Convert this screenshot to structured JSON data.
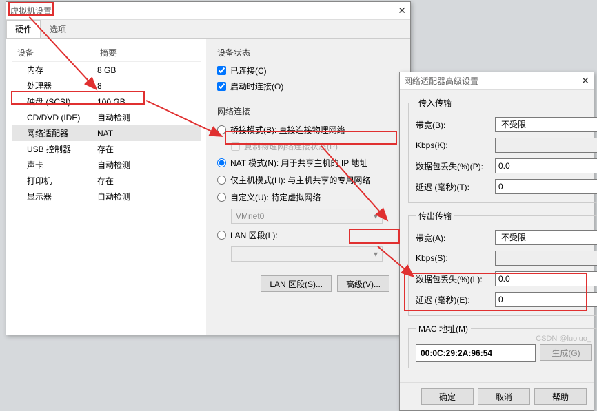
{
  "vm_settings": {
    "title": "虚拟机设置",
    "tabs": {
      "hardware": "硬件",
      "options": "选项"
    },
    "dev_header": {
      "device": "设备",
      "summary": "摘要"
    },
    "devices": [
      {
        "name": "内存",
        "summary": "8 GB",
        "icon": "memory-icon"
      },
      {
        "name": "处理器",
        "summary": "8",
        "icon": "cpu-icon"
      },
      {
        "name": "硬盘 (SCSI)",
        "summary": "100 GB",
        "icon": "disk-icon"
      },
      {
        "name": "CD/DVD (IDE)",
        "summary": "自动检测",
        "icon": "cd-icon"
      },
      {
        "name": "网络适配器",
        "summary": "NAT",
        "icon": "network-icon",
        "selected": true
      },
      {
        "name": "USB 控制器",
        "summary": "存在",
        "icon": "usb-icon"
      },
      {
        "name": "声卡",
        "summary": "自动检测",
        "icon": "sound-icon"
      },
      {
        "name": "打印机",
        "summary": "存在",
        "icon": "printer-icon"
      },
      {
        "name": "显示器",
        "summary": "自动检测",
        "icon": "display-icon"
      }
    ],
    "device_status": {
      "legend": "设备状态",
      "connected": "已连接(C)",
      "connect_at_poweron": "启动时连接(O)"
    },
    "network": {
      "legend": "网络连接",
      "bridged": "桥接模式(B): 直接连接物理网络",
      "replicate": "复制物理网络连接状态(P)",
      "nat": "NAT 模式(N): 用于共享主机的 IP 地址",
      "hostonly": "仅主机模式(H): 与主机共享的专用网络",
      "custom": "自定义(U): 特定虚拟网络",
      "vmnet": "VMnet0",
      "lan_segment": "LAN 区段(L):",
      "lan_btn": "LAN 区段(S)...",
      "advanced_btn": "高级(V)..."
    }
  },
  "advanced": {
    "title": "网络适配器高级设置",
    "incoming": {
      "legend": "传入传输",
      "bandwidth": "带宽(B):",
      "bandwidth_val": "不受限",
      "kbps": "Kbps(K):",
      "kbps_val": "",
      "loss": "数据包丢失(%)(P):",
      "loss_val": "0.0",
      "latency": "延迟 (毫秒)(T):",
      "latency_val": "0"
    },
    "outgoing": {
      "legend": "传出传输",
      "bandwidth": "带宽(A):",
      "bandwidth_val": "不受限",
      "kbps": "Kbps(S):",
      "kbps_val": "",
      "loss": "数据包丢失(%)(L):",
      "loss_val": "0.0",
      "latency": "延迟 (毫秒)(E):",
      "latency_val": "0"
    },
    "mac": {
      "legend": "MAC 地址(M)",
      "value": "00:0C:29:2A:96:54",
      "generate": "生成(G)"
    },
    "ok": "确定",
    "cancel": "取消",
    "help": "帮助"
  },
  "watermark": "CSDN @luoluo_"
}
